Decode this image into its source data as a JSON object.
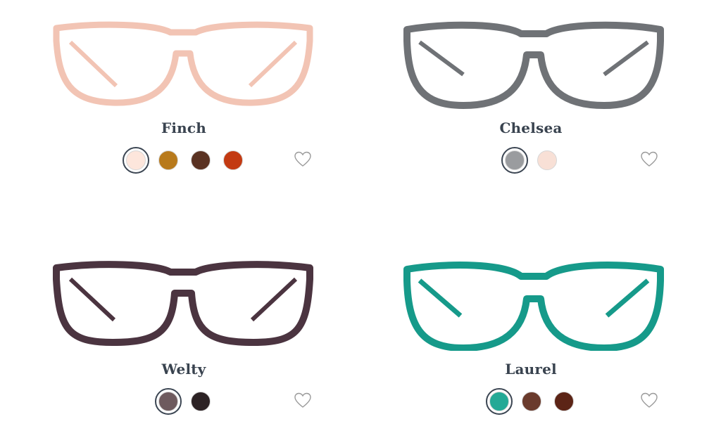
{
  "products": [
    {
      "name": "Finch",
      "frame_color": "#f2c4b4",
      "swatches": [
        {
          "fill": "#fde6dc",
          "active": true
        },
        {
          "fill": "#b87a1c",
          "active": false
        },
        {
          "fill": "#5a3222",
          "active": false
        },
        {
          "fill": "#c33a12",
          "active": false
        }
      ]
    },
    {
      "name": "Chelsea",
      "frame_color": "#6f7276",
      "swatches": [
        {
          "fill": "#9a9c9f",
          "active": true
        },
        {
          "fill": "#f8e0d6",
          "active": false
        }
      ]
    },
    {
      "name": "Welty",
      "frame_color": "#4b3440",
      "swatches": [
        {
          "fill": "#6e5a5e",
          "active": true
        },
        {
          "fill": "#2c2224",
          "active": false
        }
      ]
    },
    {
      "name": "Laurel",
      "frame_color": "#169a8a",
      "swatches": [
        {
          "fill": "#23a996",
          "active": true
        },
        {
          "fill": "#6a3a2c",
          "active": false
        },
        {
          "fill": "#5c2416",
          "active": false
        }
      ]
    }
  ],
  "colors": {
    "name_text": "#39434f",
    "heart_stroke": "#9a9a9a"
  }
}
